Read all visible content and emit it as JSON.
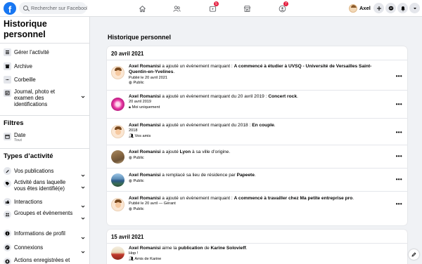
{
  "colors": {
    "brand": "#1877f2",
    "badge": "#e41e3f",
    "background": "#f0f2f5"
  },
  "topbar": {
    "logo_letter": "f",
    "search_placeholder": "Rechercher sur Facebook",
    "nav": [
      {
        "icon": "home-icon"
      },
      {
        "icon": "friends-icon"
      },
      {
        "icon": "watch-icon",
        "badge": "5"
      },
      {
        "icon": "marketplace-icon"
      },
      {
        "icon": "groups-icon",
        "badge": "7"
      }
    ],
    "profile_name": "Axel",
    "actions": [
      "create-plus-icon",
      "messenger-icon",
      "notifications-bell-icon",
      "account-menu-caret-icon"
    ]
  },
  "sidebar": {
    "title": "Historique personnel",
    "top_items": [
      {
        "label": "Gérer l’activité",
        "icon": "manage-activity-icon"
      },
      {
        "label": "Archive",
        "icon": "archive-icon"
      },
      {
        "label": "Corbeille",
        "icon": "trash-icon"
      },
      {
        "label": "Journal, photo et examen des identifications",
        "icon": "journal-review-icon",
        "has_chevron": true
      }
    ],
    "filters_heading": "Filtres",
    "date_filter": {
      "label": "Date",
      "value": "Tout"
    },
    "activity_types_heading": "Types d’activité",
    "activity_items": [
      {
        "label": "Vos publications",
        "icon": "posts-icon"
      },
      {
        "label": "Activité dans laquelle vous êtes identifié(e)",
        "icon": "tag-icon"
      },
      {
        "label": "Interactions",
        "icon": "interactions-icon"
      },
      {
        "label": "Groupes et évènements",
        "icon": "groups-events-icon"
      },
      {
        "label": "Informations de profil",
        "icon": "profile-info-icon"
      },
      {
        "label": "Connexions",
        "icon": "connections-icon"
      },
      {
        "label": "Actions enregistrées et autres activités",
        "icon": "saved-actions-icon"
      }
    ]
  },
  "main": {
    "title": "Historique personnel",
    "groups": [
      {
        "date": "20 avril 2021",
        "entries": [
          {
            "actor": "Axel Romanisi",
            "action": " a ajouté un évènement marquant : ",
            "object": "A commencé à étudier à UVSQ - Université de Versailles Saint-Quentin-en-Yvelines",
            "suffix": ".",
            "detail": "Publié le 20 avril 2021",
            "privacy": "Public",
            "privacy_icon": "globe-icon",
            "thumb": "axel-avatar"
          },
          {
            "actor": "Axel Romanisi",
            "action": " a ajouté un évènement marquant du 20 avril 2019 : ",
            "object": "Concert rock",
            "suffix": ".",
            "detail": "20 avril 2019",
            "privacy": "Moi uniquement",
            "privacy_icon": "lock-icon",
            "thumb": "concert-image"
          },
          {
            "actor": "Axel Romanisi",
            "action": " a ajouté un évènement marquant du 2018 : ",
            "object": "En couple",
            "suffix": ".",
            "detail": "2018",
            "privacy": "Vos amis",
            "privacy_icon": "friends-icon",
            "thumb": "axel-avatar"
          },
          {
            "actor": "Axel Romanisi",
            "action": " a ajouté ",
            "object": "Lyon",
            "suffix": " à sa ville d’origine.",
            "detail": "",
            "privacy": "Public",
            "privacy_icon": "globe-icon",
            "thumb": "lyon-image"
          },
          {
            "actor": "Axel Romanisi",
            "action": " a remplacé sa lieu de résidence par ",
            "object": "Papeete",
            "suffix": ".",
            "detail": "",
            "privacy": "Public",
            "privacy_icon": "globe-icon",
            "thumb": "papeete-image"
          },
          {
            "actor": "Axel Romanisi",
            "action": " a ajouté un évènement marquant : ",
            "object": "A commencé à travailler chez Ma petite entreprise pro",
            "suffix": ".",
            "detail": "Publié le 20 avril — Gérant",
            "privacy": "Public",
            "privacy_icon": "globe-icon",
            "thumb": "axel-avatar"
          }
        ]
      },
      {
        "date": "15 avril 2021",
        "entries": [
          {
            "actor": "Axel Romanisi",
            "action": " aime la ",
            "object": "publication",
            "suffix": " de ",
            "object2": "Karine Solovieff",
            "suffix2": ".",
            "detail": "Hop !",
            "privacy": "Amis de Karine",
            "privacy_icon": "friends-icon",
            "thumb": "karine-post-image"
          }
        ]
      }
    ]
  }
}
